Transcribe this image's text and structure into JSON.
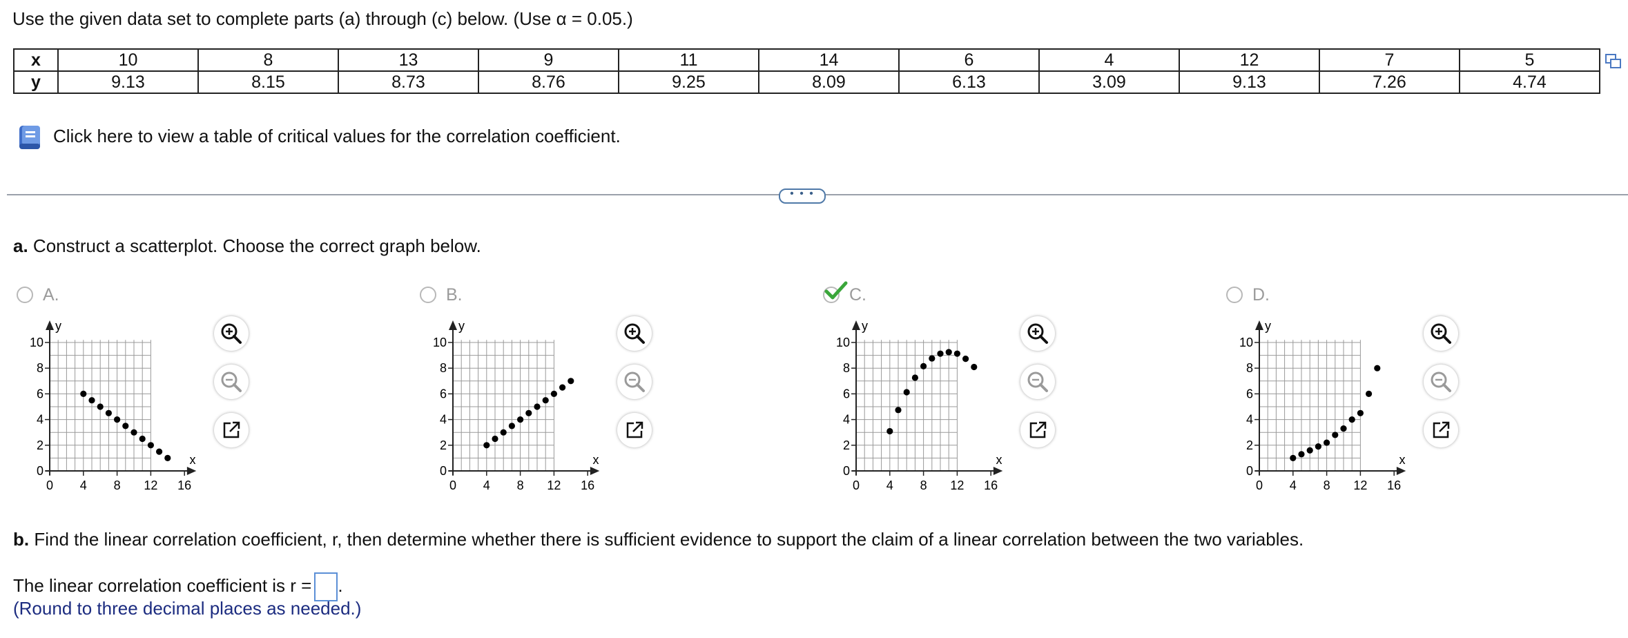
{
  "intro_text": "Use the given data set to complete parts (a) through (c) below. (Use α = 0.05.)",
  "data_table": {
    "x_header": "x",
    "y_header": "y",
    "x": [
      "10",
      "8",
      "13",
      "9",
      "11",
      "14",
      "6",
      "4",
      "12",
      "7",
      "5"
    ],
    "y": [
      "9.13",
      "8.15",
      "8.73",
      "8.76",
      "9.25",
      "8.09",
      "6.13",
      "3.09",
      "9.13",
      "7.26",
      "4.74"
    ]
  },
  "critical_values_link": "Click here to view a table of critical values for the correlation coefficient.",
  "more_button": "• • •",
  "part_a": {
    "letter": "a.",
    "text": "Construct a scatterplot. Choose the correct graph below."
  },
  "options": [
    {
      "label": "A.",
      "selected": false
    },
    {
      "label": "B.",
      "selected": false
    },
    {
      "label": "C.",
      "selected": true
    },
    {
      "label": "D.",
      "selected": false
    }
  ],
  "axis": {
    "y_label": "y",
    "x_label": "x",
    "y_ticks": [
      "10",
      "8",
      "6",
      "4",
      "2",
      "0"
    ],
    "x_ticks": [
      "0",
      "4",
      "8",
      "12",
      "16"
    ]
  },
  "chart_data": [
    {
      "type": "scatter",
      "xlabel": "x",
      "ylabel": "y",
      "xlim": [
        0,
        16
      ],
      "ylim": [
        0,
        10
      ],
      "x": [
        4,
        5,
        6,
        7,
        8,
        9,
        10,
        11,
        12,
        13,
        14
      ],
      "y": [
        6,
        5.5,
        5,
        4.5,
        4,
        3.5,
        3,
        2.5,
        2,
        1.5,
        1
      ]
    },
    {
      "type": "scatter",
      "xlabel": "x",
      "ylabel": "y",
      "xlim": [
        0,
        16
      ],
      "ylim": [
        0,
        10
      ],
      "x": [
        4,
        5,
        6,
        7,
        8,
        9,
        10,
        11,
        12,
        13,
        14
      ],
      "y": [
        2,
        2.5,
        3,
        3.5,
        4,
        4.5,
        5,
        5.5,
        6,
        6.5,
        7
      ]
    },
    {
      "type": "scatter",
      "xlabel": "x",
      "ylabel": "y",
      "xlim": [
        0,
        16
      ],
      "ylim": [
        0,
        10
      ],
      "x": [
        4,
        5,
        6,
        7,
        8,
        9,
        10,
        11,
        12,
        13,
        14
      ],
      "y": [
        3.09,
        4.74,
        6.13,
        7.26,
        8.15,
        8.76,
        9.13,
        9.25,
        9.13,
        8.73,
        8.09
      ]
    },
    {
      "type": "scatter",
      "xlabel": "x",
      "ylabel": "y",
      "xlim": [
        0,
        16
      ],
      "ylim": [
        0,
        10
      ],
      "x": [
        4,
        5,
        6,
        7,
        8,
        9,
        10,
        11,
        12,
        13,
        14
      ],
      "y": [
        1,
        1.3,
        1.6,
        1.9,
        2.2,
        2.8,
        3.3,
        4,
        4.5,
        6,
        8
      ]
    }
  ],
  "part_b": {
    "letter": "b.",
    "text": "Find the linear correlation coefficient, r, then determine whether there is sufficient evidence to support the claim of a linear correlation between the two variables."
  },
  "r_prompt": "The linear correlation coefficient is r =",
  "r_value": "",
  "r_suffix": ".",
  "round_note": "(Round to three decimal places as needed.)",
  "colors": {
    "check": "#3aa63a",
    "link_blue": "#1c2c80",
    "input_border": "#5b8fd6"
  }
}
